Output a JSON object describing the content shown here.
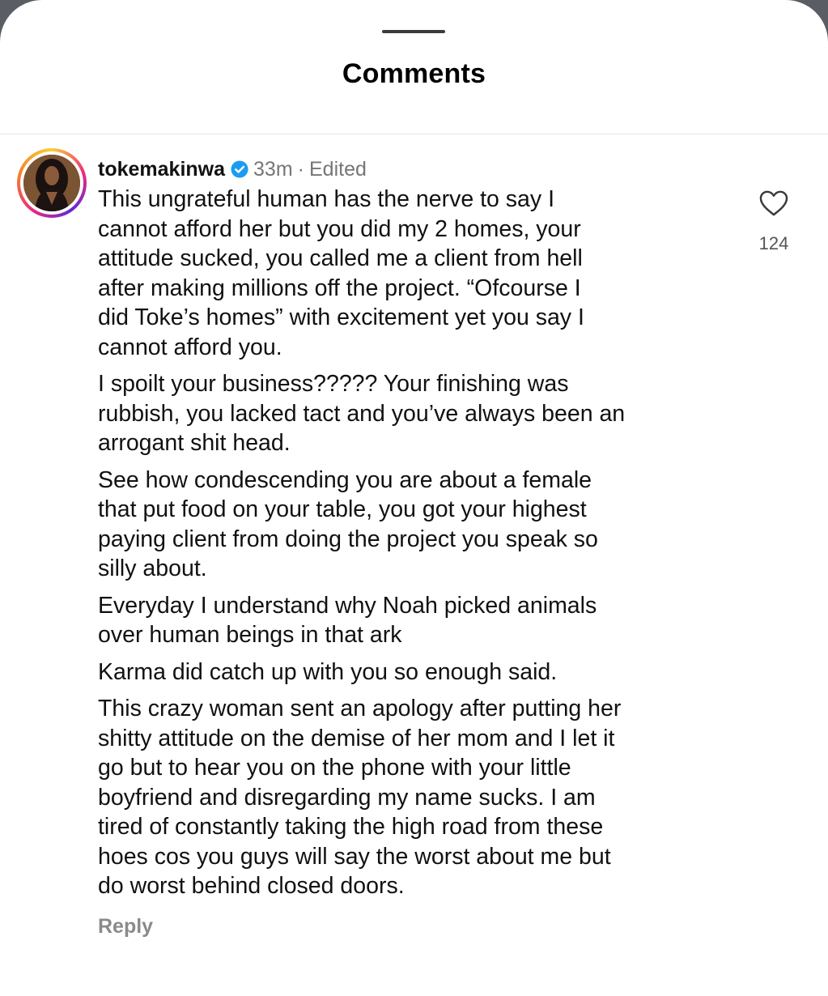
{
  "sheet": {
    "title": "Comments"
  },
  "comment": {
    "username": "tokemakinwa",
    "time": "33m",
    "separator": "·",
    "edited": "Edited",
    "verified_icon": "verified-badge-icon",
    "heart_icon": "heart-outline-icon",
    "like_count": "124",
    "reply_label": "Reply",
    "paragraphs": [
      "This ungrateful human has the nerve to say I\ncannot afford her but you did my 2 homes, your\nattitude sucked, you called me a client from hell\nafter making millions off the project. “Ofcourse I\ndid Toke’s homes” with excitement yet you say I\ncannot afford you.",
      "I spoilt your business????? Your finishing was\nrubbish, you lacked tact and you’ve always been an\narrogant shit head.",
      "See how condescending you are about a female\nthat put food on your table, you got your highest\npaying client from doing the project you speak so\nsilly about.",
      "Everyday I understand why Noah picked animals\nover human beings in that ark",
      "Karma did catch up with you so enough said.",
      "This crazy woman sent an apology after putting her\nshitty attitude on the demise of her mom and I let it\ngo but to hear you on the phone with your little\nboyfriend and disregarding my name sucks. I am\ntired of constantly taking the high road from these\nhoes cos you guys will say the worst about me but\ndo worst behind closed doors."
    ]
  },
  "colors": {
    "verified_blue": "#1d9bf0",
    "muted_text": "#767676",
    "story_ring": [
      "#f9ce34",
      "#ee2a7b",
      "#6228d7"
    ]
  }
}
